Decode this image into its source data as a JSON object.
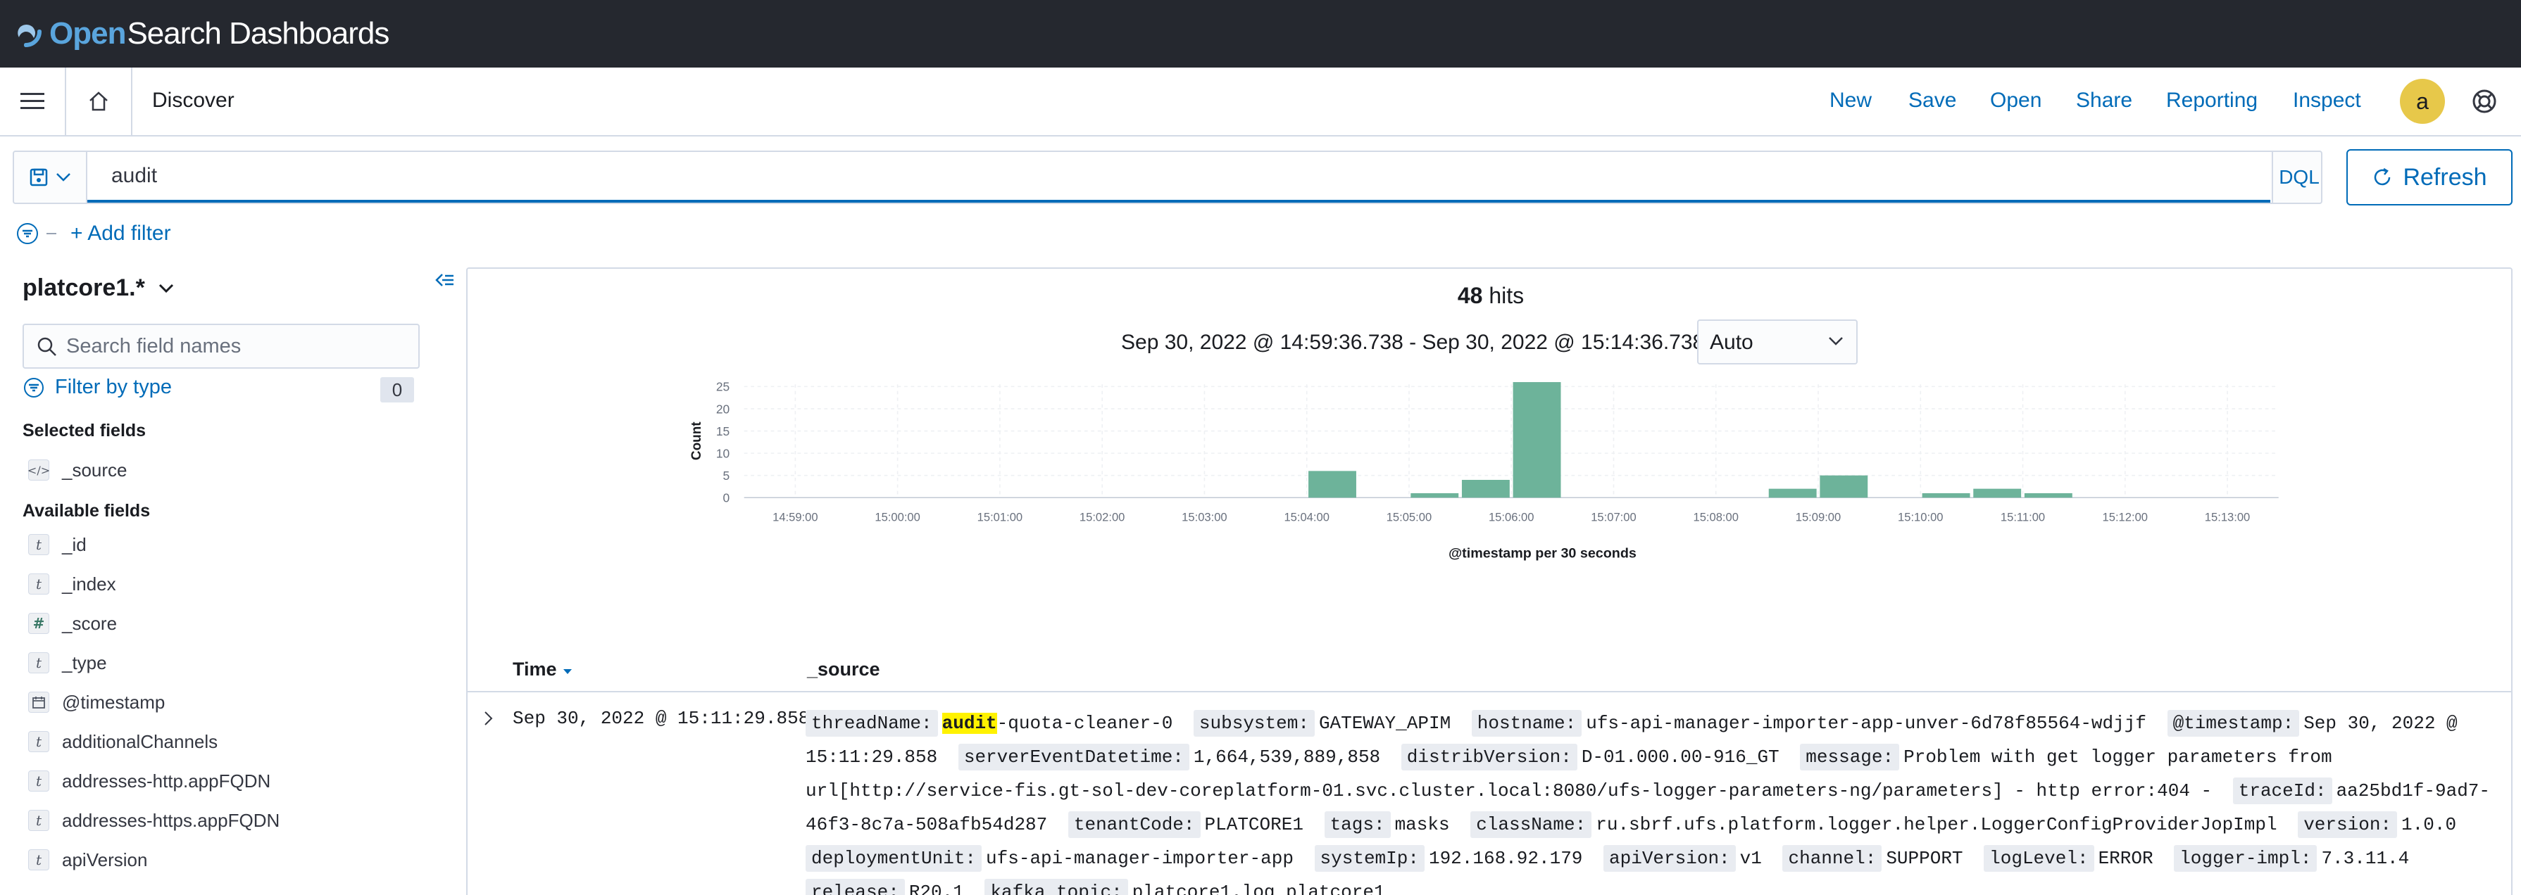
{
  "app": {
    "logo_open": "Open",
    "logo_rest": "Search Dashboards"
  },
  "header": {
    "breadcrumb": "Discover",
    "menu": [
      "New",
      "Save",
      "Open",
      "Share",
      "Reporting",
      "Inspect"
    ],
    "avatar": "a"
  },
  "query": {
    "value": "audit",
    "language": "DQL",
    "refresh_label": "Refresh"
  },
  "filters": {
    "add_filter": "+ Add filter"
  },
  "sidebar": {
    "index_pattern": "platcore1.*",
    "search_placeholder": "Search field names",
    "filter_by_type": "Filter by type",
    "filter_count": "0",
    "selected_title": "Selected fields",
    "selected_fields": [
      {
        "type": "source",
        "name": "_source"
      }
    ],
    "available_title": "Available fields",
    "available_fields": [
      {
        "type": "t",
        "name": "_id"
      },
      {
        "type": "t",
        "name": "_index"
      },
      {
        "type": "#",
        "name": "_score"
      },
      {
        "type": "t",
        "name": "_type"
      },
      {
        "type": "date",
        "name": "@timestamp"
      },
      {
        "type": "t",
        "name": "additionalChannels"
      },
      {
        "type": "t",
        "name": "addresses-http.appFQDN"
      },
      {
        "type": "t",
        "name": "addresses-https.appFQDN"
      },
      {
        "type": "t",
        "name": "apiVersion"
      }
    ]
  },
  "results": {
    "hits_count": "48",
    "hits_label": "hits",
    "time_range": "Sep 30, 2022 @ 14:59:36.738 - Sep 30, 2022 @ 15:14:36.738",
    "interval": "Auto",
    "col_time": "Time",
    "col_source": "_source",
    "rows": [
      {
        "time": "Sep 30, 2022 @ 15:11:29.858",
        "highlight": "audit",
        "fields": [
          {
            "k": "threadName:",
            "pre": "",
            "hl": "audit",
            "v": "-quota-cleaner-0"
          },
          {
            "k": "subsystem:",
            "v": "GATEWAY_APIM"
          },
          {
            "k": "hostname:",
            "v": "ufs-api-manager-importer-app-unver-6d78f85564-wdjjf"
          },
          {
            "k": "@timestamp:",
            "v": "Sep 30, 2022 @ 15:11:29.858"
          },
          {
            "k": "serverEventDatetime:",
            "v": "1,664,539,889,858"
          },
          {
            "k": "distribVersion:",
            "v": "D-01.000.00-916_GT"
          },
          {
            "k": "message:",
            "v": "Problem with get logger parameters from url[http://service-fis.gt-sol-dev-coreplatform-01.svc.cluster.local:8080/ufs-logger-parameters-ng/parameters] - http error:404 -"
          },
          {
            "k": "traceId:",
            "v": "aa25bd1f-9ad7-46f3-8c7a-508afb54d287"
          },
          {
            "k": "tenantCode:",
            "v": "PLATCORE1"
          },
          {
            "k": "tags:",
            "v": "masks"
          },
          {
            "k": "className:",
            "v": "ru.sbrf.ufs.platform.logger.helper.LoggerConfigProviderJopImpl"
          },
          {
            "k": "version:",
            "v": "1.0.0"
          },
          {
            "k": "deploymentUnit:",
            "v": "ufs-api-manager-importer-app"
          },
          {
            "k": "systemIp:",
            "v": "192.168.92.179"
          },
          {
            "k": "apiVersion:",
            "v": "v1"
          },
          {
            "k": "channel:",
            "v": "SUPPORT"
          },
          {
            "k": "logLevel:",
            "v": "ERROR"
          },
          {
            "k": "logger-impl:",
            "v": "7.3.11.4"
          },
          {
            "k": "release:",
            "v": "R20.1"
          },
          {
            "k": "kafka_topic:",
            "v": "platcore1.log_platcore1"
          }
        ]
      }
    ]
  },
  "colors": {
    "topbar": "#25282f",
    "accent": "#006bb8",
    "bar": "#6db39a",
    "highlight": "#fff200"
  },
  "chart_data": {
    "type": "bar",
    "ylabel": "Count",
    "xlabel": "@timestamp per 30 seconds",
    "ylim": [
      0,
      25
    ],
    "yticks": [
      0,
      5,
      10,
      15,
      20,
      25
    ],
    "xticks": [
      "14:59:00",
      "15:00:00",
      "15:01:00",
      "15:02:00",
      "15:03:00",
      "15:04:00",
      "15:05:00",
      "15:06:00",
      "15:07:00",
      "15:08:00",
      "15:09:00",
      "15:10:00",
      "15:11:00",
      "15:12:00",
      "15:13:00"
    ],
    "bars": [
      {
        "t": "15:04:00",
        "value": 6
      },
      {
        "t": "15:05:00",
        "value": 1
      },
      {
        "t": "15:05:30",
        "value": 4
      },
      {
        "t": "15:06:00",
        "value": 26
      },
      {
        "t": "15:08:30",
        "value": 2
      },
      {
        "t": "15:09:00",
        "value": 5
      },
      {
        "t": "15:10:00",
        "value": 1
      },
      {
        "t": "15:10:30",
        "value": 2
      },
      {
        "t": "15:11:00",
        "value": 1
      }
    ],
    "grid": true
  }
}
